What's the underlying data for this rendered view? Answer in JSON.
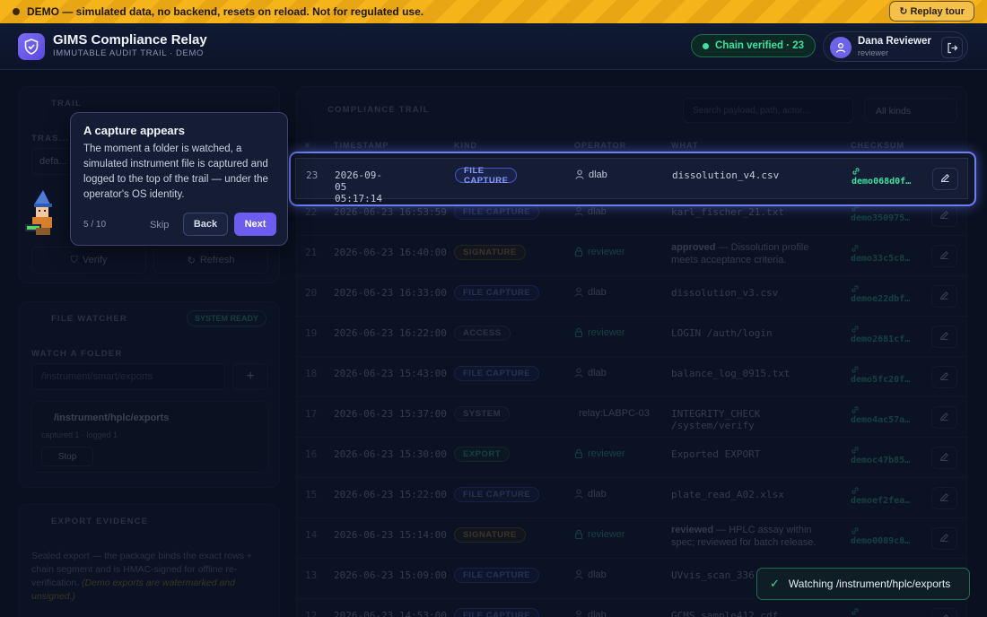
{
  "banner": {
    "text": "DEMO — simulated data, no backend, resets on reload. Not for regulated use.",
    "replay_label": "Replay tour"
  },
  "header": {
    "title": "GIMS Compliance Relay",
    "subtitle": "IMMUTABLE AUDIT TRAIL · DEMO",
    "chain_status": "Chain verified · 23",
    "user_name": "Dana Reviewer",
    "user_role": "reviewer"
  },
  "trail_panel": {
    "title": "TRAIL",
    "tras_label": "TRAS...",
    "default_value": "defa...",
    "verify_label": "Verify",
    "refresh_label": "Refresh"
  },
  "watcher": {
    "title": "FILE WATCHER",
    "status": "SYSTEM READY",
    "watch_label": "WATCH A FOLDER",
    "input_placeholder": "/instrument/smart/exports",
    "path": "/instrument/hplc/exports",
    "stats": "captured 1 · logged 1",
    "stop_label": "Stop"
  },
  "export": {
    "title": "EXPORT EVIDENCE",
    "text": "Sealed export — the package binds the exact rows + chain segment and is HMAC-signed for offline re-verification.",
    "note": "(Demo exports are watermarked and unsigned.)"
  },
  "table": {
    "title": "COMPLIANCE TRAIL",
    "search_placeholder": "Search payload, path, actor...",
    "filter": "All kinds",
    "headers": [
      "#",
      "TIMESTAMP",
      "KIND",
      "OPERATOR",
      "WHAT",
      "CHECKSUM"
    ],
    "rows": [
      {
        "n": "23",
        "ts": "2026-09-05 05:17:14",
        "kind": "FILE CAPTURE",
        "kc": "fc",
        "op": "dlab",
        "opicon": "user",
        "what": "dissolution_v4.csv",
        "ck": "demo068d0f…"
      },
      {
        "n": "22",
        "ts": "2026-06-23 16:53:59",
        "kind": "FILE CAPTURE",
        "kc": "fc",
        "op": "dlab",
        "opicon": "user",
        "what": "karl_fischer_21.txt",
        "ck": "demo350975…"
      },
      {
        "n": "21",
        "ts": "2026-06-23 16:40:00",
        "kind": "SIGNATURE",
        "kc": "sig",
        "op": "reviewer",
        "opicon": "lock",
        "what_b": "approved",
        "what": " — Dissolution profile meets acceptance criteria.",
        "ck": "demo33c5c8…"
      },
      {
        "n": "20",
        "ts": "2026-06-23 16:33:00",
        "kind": "FILE CAPTURE",
        "kc": "fc",
        "op": "dlab",
        "opicon": "user",
        "what": "dissolution_v3.csv",
        "ck": "demoe22dbf…"
      },
      {
        "n": "19",
        "ts": "2026-06-23 16:22:00",
        "kind": "ACCESS",
        "kc": "acc",
        "op": "reviewer",
        "opicon": "lock",
        "what": "LOGIN /auth/login",
        "ck": "demo2681cf…"
      },
      {
        "n": "18",
        "ts": "2026-06-23 15:43:00",
        "kind": "FILE CAPTURE",
        "kc": "fc",
        "op": "dlab",
        "opicon": "user",
        "what": "balance_log_0915.txt",
        "ck": "demo5fc20f…"
      },
      {
        "n": "17",
        "ts": "2026-06-23 15:37:00",
        "kind": "SYSTEM",
        "kc": "sys",
        "op": "relay:LABPC-03",
        "opicon": "",
        "what": "INTEGRITY_CHECK /system/verify",
        "ck": "demo4ac57a…"
      },
      {
        "n": "16",
        "ts": "2026-06-23 15:30:00",
        "kind": "EXPORT",
        "kc": "exp",
        "op": "reviewer",
        "opicon": "lock",
        "what": "Exported EXPORT",
        "ck": "democ47b85…"
      },
      {
        "n": "15",
        "ts": "2026-06-23 15:22:00",
        "kind": "FILE CAPTURE",
        "kc": "fc",
        "op": "dlab",
        "opicon": "user",
        "what": "plate_read_A02.xlsx",
        "ck": "demoef2fea…"
      },
      {
        "n": "14",
        "ts": "2026-06-23 15:14:00",
        "kind": "SIGNATURE",
        "kc": "sig",
        "op": "reviewer",
        "opicon": "lock",
        "what_b": "reviewed",
        "what": " — HPLC assay within spec; reviewed for batch release.",
        "ck": "demo0089c8…"
      },
      {
        "n": "13",
        "ts": "2026-06-23 15:09:00",
        "kind": "FILE CAPTURE",
        "kc": "fc",
        "op": "dlab",
        "opicon": "user",
        "what": "UVvis_scan_336.csv",
        "ck": "demo7a12b4…"
      },
      {
        "n": "12",
        "ts": "2026-06-23 14:53:00",
        "kind": "FILE CAPTURE",
        "kc": "fc",
        "op": "dlab",
        "opicon": "user",
        "what": "GCMS_sample412.cdf",
        "ck": "demo91e0d2…"
      }
    ]
  },
  "tour": {
    "title": "A capture appears",
    "body": "The moment a folder is watched, a simulated instrument file is captured and logged to the top of the trail — under the operator's OS identity.",
    "step": "5 / 10",
    "skip": "Skip",
    "back": "Back",
    "next": "Next"
  },
  "toast": {
    "text": "Watching /instrument/hplc/exports"
  }
}
